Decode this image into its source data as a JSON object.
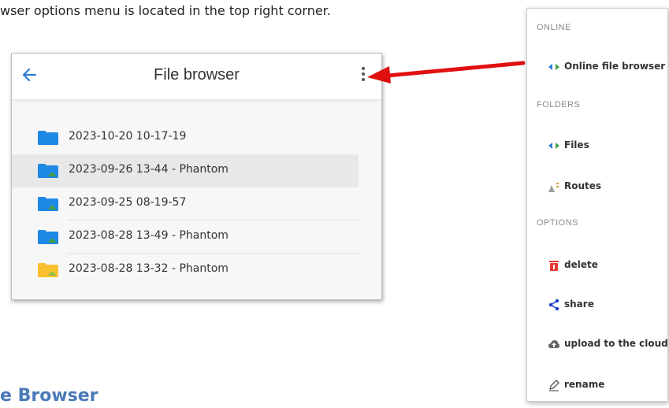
{
  "caption": "wser options menu is located in the top right corner.",
  "file_browser": {
    "title": "File browser",
    "back_icon": "arrow-left",
    "menu_icon": "kebab-vertical",
    "folders": [
      {
        "name": "2023-10-20 10-17-19",
        "icon": "folder-plain",
        "color": "#1e88e5",
        "selected": false
      },
      {
        "name": "2023-09-26 13-44 - Phantom",
        "icon": "folder-image",
        "color": "#1e88e5",
        "selected": true
      },
      {
        "name": "2023-09-25 08-19-57",
        "icon": "folder-image",
        "color": "#1e88e5",
        "selected": false
      },
      {
        "name": "2023-08-28 13-49 - Phantom",
        "icon": "folder-image",
        "color": "#1e88e5",
        "selected": false
      },
      {
        "name": "2023-08-28 13-32 - Phantom",
        "icon": "folder-image",
        "color": "#fbc02d",
        "selected": false
      }
    ]
  },
  "options_menu": {
    "sections": [
      {
        "header": "ONLINE",
        "items": [
          {
            "label": "Online file browser",
            "icon": "online-icon"
          }
        ]
      },
      {
        "header": "FOLDERS",
        "items": [
          {
            "label": "Files",
            "icon": "files-icon"
          },
          {
            "label": "Routes",
            "icon": "routes-icon"
          }
        ]
      },
      {
        "header": "OPTIONS",
        "items": [
          {
            "label": "delete",
            "icon": "trash-icon"
          },
          {
            "label": "share",
            "icon": "share-icon"
          },
          {
            "label": "upload to the cloud",
            "icon": "cloud-upload-icon"
          },
          {
            "label": "rename",
            "icon": "pencil-icon"
          }
        ]
      }
    ]
  },
  "bottom_heading": "e Browser",
  "colors": {
    "accent_blue": "#1e88e5",
    "arrow_red": "#e01010",
    "heading_blue": "#4a7ab8",
    "trash_red": "#e53935",
    "share_blue": "#1e3fc8"
  }
}
